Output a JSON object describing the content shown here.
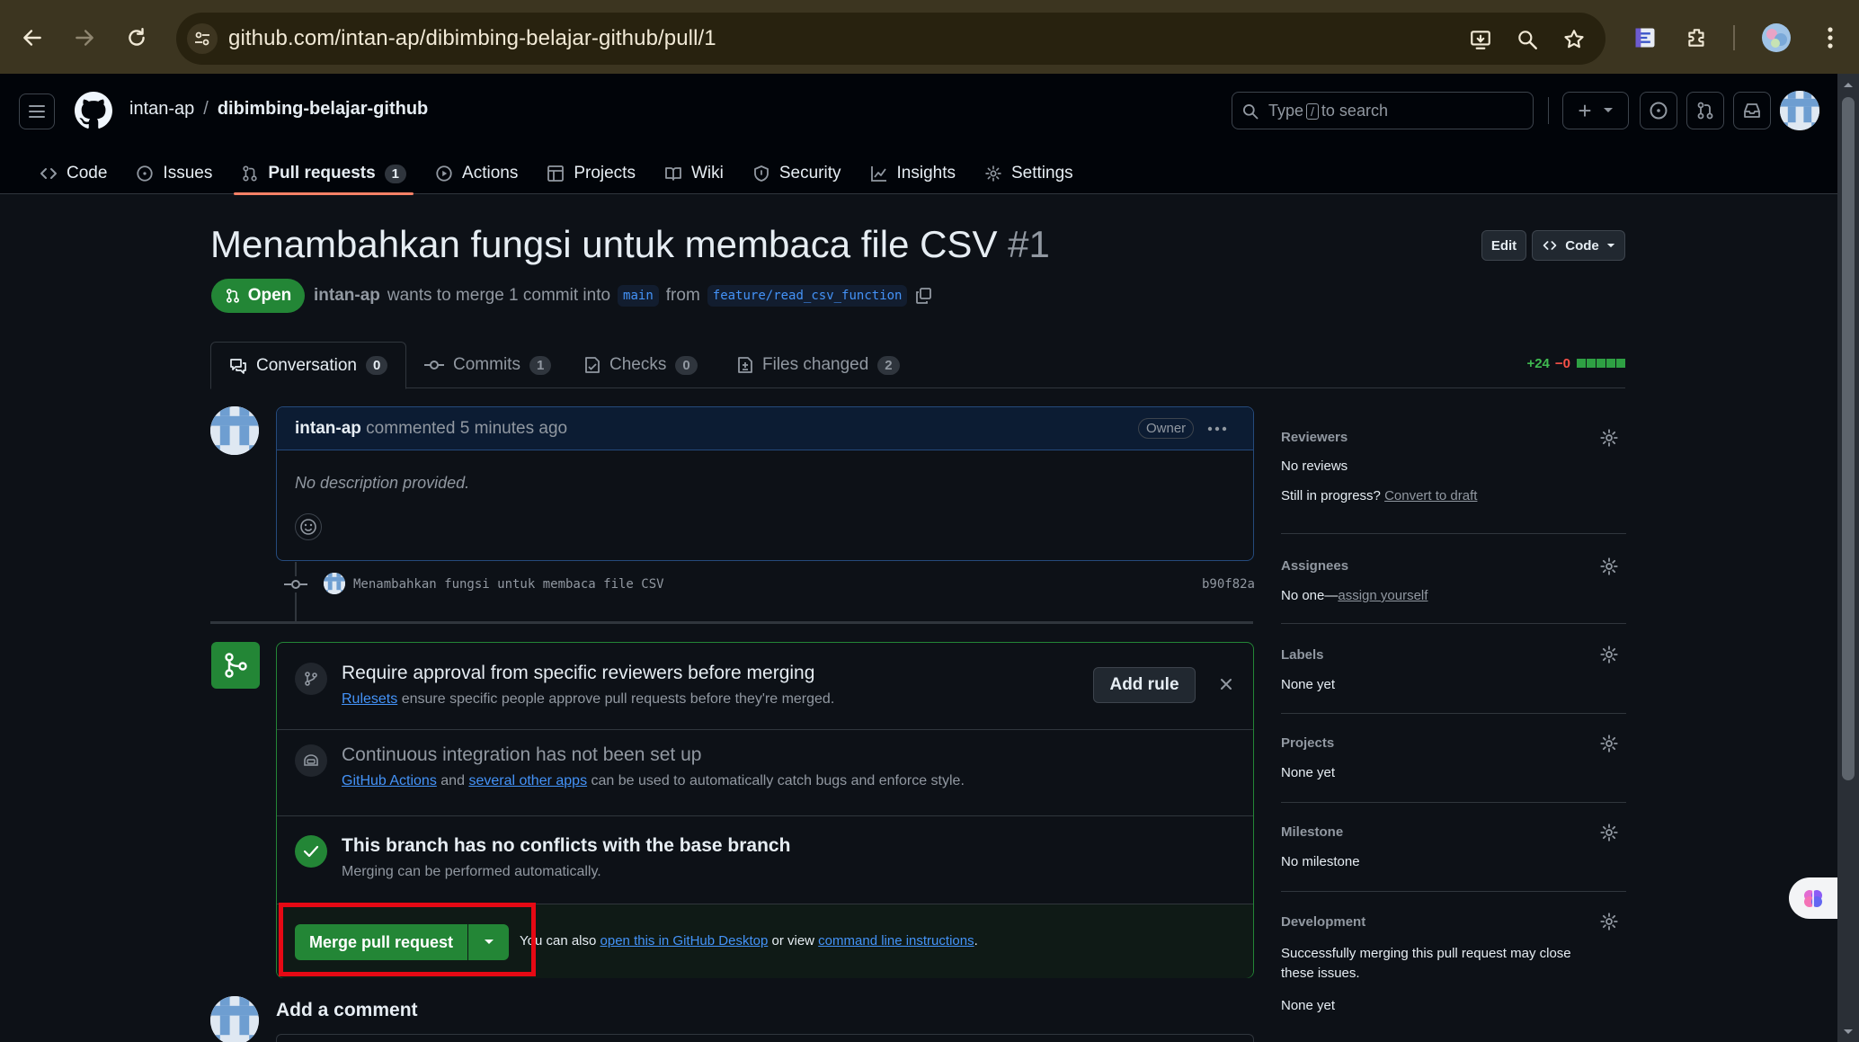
{
  "browser": {
    "url": "github.com/intan-ap/dibimbing-belajar-github/pull/1"
  },
  "header": {
    "owner": "intan-ap",
    "slash": "/",
    "repo": "dibimbing-belajar-github",
    "search_prefix": "Type",
    "search_key": "/",
    "search_suffix": "to search",
    "plus": "+"
  },
  "nav": {
    "code": "Code",
    "issues": "Issues",
    "pull_requests": "Pull requests",
    "pull_requests_count": "1",
    "actions": "Actions",
    "projects": "Projects",
    "wiki": "Wiki",
    "security": "Security",
    "insights": "Insights",
    "settings": "Settings"
  },
  "pr": {
    "title": "Menambahkan fungsi untuk membaca file CSV",
    "number": "#1",
    "edit_label": "Edit",
    "code_label": "Code",
    "state": "Open",
    "author": "intan-ap",
    "meta_text": "wants to merge 1 commit into",
    "base_branch": "main",
    "from_text": "from",
    "head_branch": "feature/read_csv_function"
  },
  "tabs": {
    "conversation": "Conversation",
    "conversation_count": "0",
    "commits": "Commits",
    "commits_count": "1",
    "checks": "Checks",
    "checks_count": "0",
    "files_changed": "Files changed",
    "files_changed_count": "2",
    "additions": "+24",
    "deletions": "−0"
  },
  "comment": {
    "author": "intan-ap",
    "action": "commented 5 minutes ago",
    "badge": "Owner",
    "body": "No description provided."
  },
  "commit": {
    "message": "Menambahkan fungsi untuk membaca file CSV",
    "sha": "b90f82a"
  },
  "merge": {
    "rule_title": "Require approval from specific reviewers before merging",
    "rule_link": "Rulesets",
    "rule_text": "ensure specific people approve pull requests before they're merged.",
    "add_rule": "Add rule",
    "ci_title": "Continuous integration has not been set up",
    "ci_link1": "GitHub Actions",
    "ci_and": "and",
    "ci_link2": "several other apps",
    "ci_text": "can be used to automatically catch bugs and enforce style.",
    "conflict_title": "This branch has no conflicts with the base branch",
    "conflict_sub": "Merging can be performed automatically.",
    "merge_button": "Merge pull request",
    "note_prefix": "You can also",
    "note_link1": "open this in GitHub Desktop",
    "note_mid": "or view",
    "note_link2": "command line instructions",
    "note_end": "."
  },
  "add_comment": "Add a comment",
  "sidebar": {
    "reviewers_title": "Reviewers",
    "reviewers_value": "No reviews",
    "still_progress": "Still in progress?",
    "convert_draft": "Convert to draft",
    "assignees_title": "Assignees",
    "assignees_value": "No one—",
    "assign_yourself": "assign yourself",
    "labels_title": "Labels",
    "labels_value": "None yet",
    "projects_title": "Projects",
    "projects_value": "None yet",
    "milestone_title": "Milestone",
    "milestone_value": "No milestone",
    "development_title": "Development",
    "development_text": "Successfully merging this pull request may close these issues.",
    "development_value": "None yet"
  },
  "colors": {
    "accent_green": "#238636",
    "link_blue": "#4493f8",
    "highlight_red": "#e50914",
    "nav_underline": "#f78166"
  }
}
